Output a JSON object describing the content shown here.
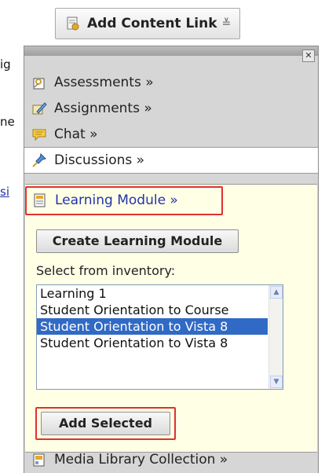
{
  "background": {
    "fragments": [
      "ig",
      "ne",
      "si"
    ]
  },
  "toolbar": {
    "add_content_link_label": "Add Content Link",
    "dropdown_glyph": "≚",
    "icon": "document-link-icon"
  },
  "menu": {
    "close_label": "✕",
    "items": [
      {
        "label": "Assessments »",
        "icon": "assessment-icon"
      },
      {
        "label": "Assignments »",
        "icon": "assignment-icon"
      },
      {
        "label": "Chat »",
        "icon": "chat-bubble-icon"
      },
      {
        "label": "Discussions »",
        "icon": "pin-icon"
      },
      {
        "label": "Media Library Collection »",
        "icon": "media-library-icon"
      }
    ],
    "learning_module": {
      "label": "Learning Module »",
      "icon": "learning-module-icon",
      "create_button": "Create Learning Module",
      "select_label": "Select from inventory:",
      "options": [
        "Learning 1",
        "Student Orientation to Course",
        "Student Orientation to Vista 8",
        "Student Orientation to Vista 8"
      ],
      "selected_index": 2,
      "add_selected_button": "Add Selected"
    }
  },
  "colors": {
    "highlight": "#e0312d",
    "selection": "#316ac5",
    "link": "#2233aa",
    "expanded_bg": "#ffffe6"
  }
}
